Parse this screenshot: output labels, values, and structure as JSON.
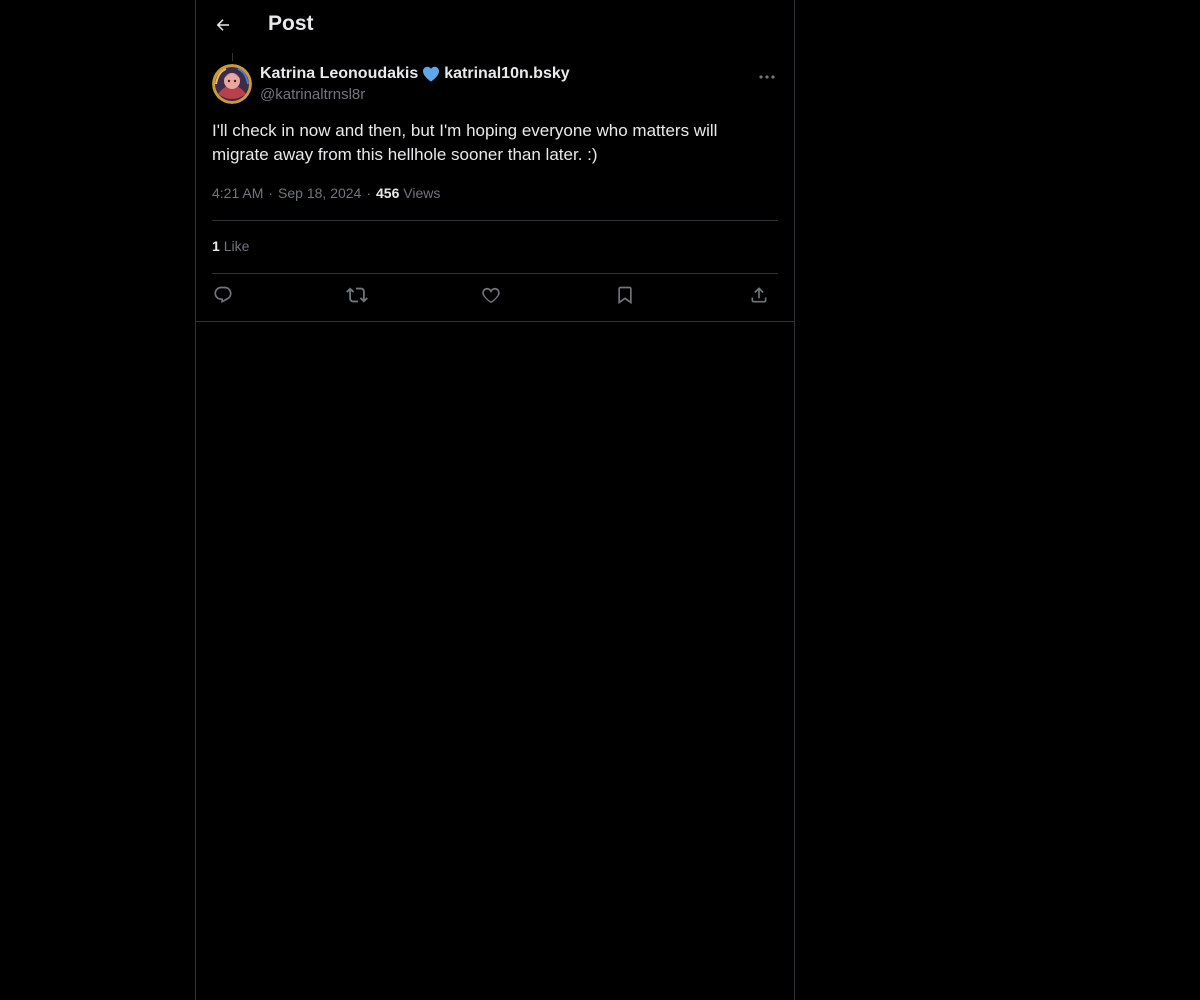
{
  "header": {
    "title": "Post"
  },
  "post": {
    "author_name": "Katrina Leonoudakis",
    "author_suffix": "katrinal10n.bsky",
    "author_handle": "@katrinaltrnsl8r",
    "text": "I'll check in now and then, but I'm hoping everyone who matters will migrate away from this hellhole sooner than later. :)",
    "time": "4:21 AM",
    "date": "Sep 18, 2024",
    "views_count": "456",
    "views_label": "Views",
    "likes_count": "1",
    "likes_label": "Like"
  },
  "icons": {
    "back": "arrow-left-icon",
    "more": "more-horizontal-icon",
    "heart_badge": "blue-heart-icon",
    "reply": "reply-icon",
    "repost": "repost-icon",
    "like": "like-icon",
    "bookmark": "bookmark-icon",
    "share": "share-icon"
  },
  "colors": {
    "background": "#000000",
    "text": "#e7e9ea",
    "secondary_text": "#71767b",
    "border": "#2f3336",
    "heart": "#5da8e8"
  }
}
